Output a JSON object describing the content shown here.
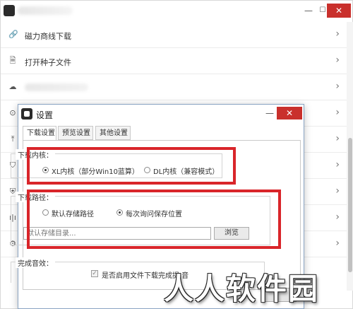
{
  "window": {
    "minimize_glyph": "—",
    "maximize_glyph": "☐",
    "close_glyph": "✕"
  },
  "main_list": {
    "items": [
      {
        "label": "磁力商线下载",
        "icon": "link-icon",
        "glyph": "🔗",
        "chevron": "›"
      },
      {
        "label": "打开种子文件",
        "icon": "file-icon",
        "glyph": "🗎",
        "chevron": "›"
      },
      {
        "label": "",
        "icon": "cloud-icon",
        "glyph": "☁",
        "chevron": "›"
      },
      {
        "label": "",
        "icon": "clock-icon",
        "glyph": "⊙",
        "chevron": "›"
      },
      {
        "label": "",
        "icon": "upload-icon",
        "glyph": "⤒",
        "chevron": "›"
      },
      {
        "label": "",
        "icon": "gift-icon",
        "glyph": "⛉",
        "chevron": "›"
      },
      {
        "label": "",
        "icon": "shield-icon",
        "glyph": "⛨",
        "chevron": "›"
      },
      {
        "label": "",
        "icon": "chart-icon",
        "glyph": "ı|ı",
        "chevron": "›"
      },
      {
        "label": "",
        "icon": "gear-icon",
        "glyph": "⚙",
        "chevron": "›"
      }
    ]
  },
  "dialog": {
    "title": "设置",
    "minimize_glyph": "—",
    "close_glyph": "✕",
    "tabs": [
      {
        "label": "下载设置",
        "active": true
      },
      {
        "label": "预览设置",
        "active": false
      },
      {
        "label": "其他设置",
        "active": false
      }
    ],
    "kernel_group": {
      "legend": "下载内核：",
      "options": [
        {
          "label": "XL内核（部分Win10蓝算）",
          "selected": true
        },
        {
          "label": "DL内核（兼容模式）",
          "selected": false
        }
      ]
    },
    "path_group": {
      "legend": "下载路径：",
      "options": [
        {
          "label": "默认存储路径",
          "selected": false
        },
        {
          "label": "每次询问保存位置",
          "selected": true
        }
      ],
      "input_placeholder": "默认存储目录...",
      "browse_label": "浏览"
    },
    "sound_group": {
      "legend": "完成音效：",
      "checkbox_label": "是否启用文件下载完成提   音",
      "checkbox_checked": true,
      "check_glyph": "✓"
    }
  },
  "watermark": "人人软件园",
  "colors": {
    "highlight_red": "#d9252a",
    "close_red": "#c9302c"
  }
}
